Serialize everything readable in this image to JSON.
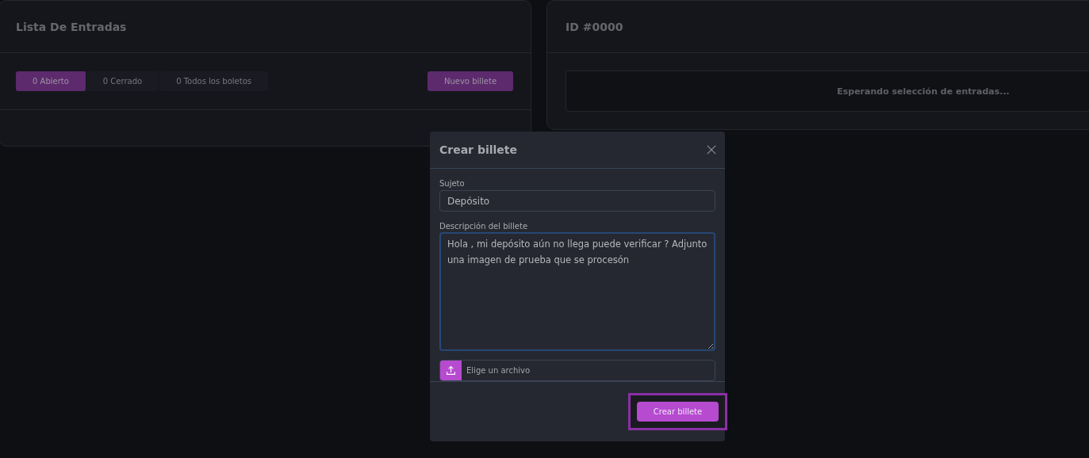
{
  "ticket_list": {
    "title": "Lista De Entradas",
    "tabs": [
      {
        "label": "0 Abierto",
        "selected": true
      },
      {
        "label": "0 Cerrado",
        "selected": false
      },
      {
        "label": "0 Todos los boletos",
        "selected": false
      }
    ],
    "new_button": "Nuevo billete"
  },
  "ticket_detail": {
    "title": "ID #0000",
    "message": "Esperando selección de entradas..."
  },
  "dialog": {
    "title": "Crear billete",
    "subject": {
      "label": "Sujeto",
      "value": "Depósito"
    },
    "description": {
      "label": "Descripción del billete",
      "value": "Hola , mi depósito aún no llega puede verificar ? Adjunto una imagen de prueba que se procesón",
      "focused": true
    },
    "file": {
      "label": "Elige un archivo"
    },
    "submit": {
      "label": "Crear billete",
      "highlighted": true
    }
  }
}
